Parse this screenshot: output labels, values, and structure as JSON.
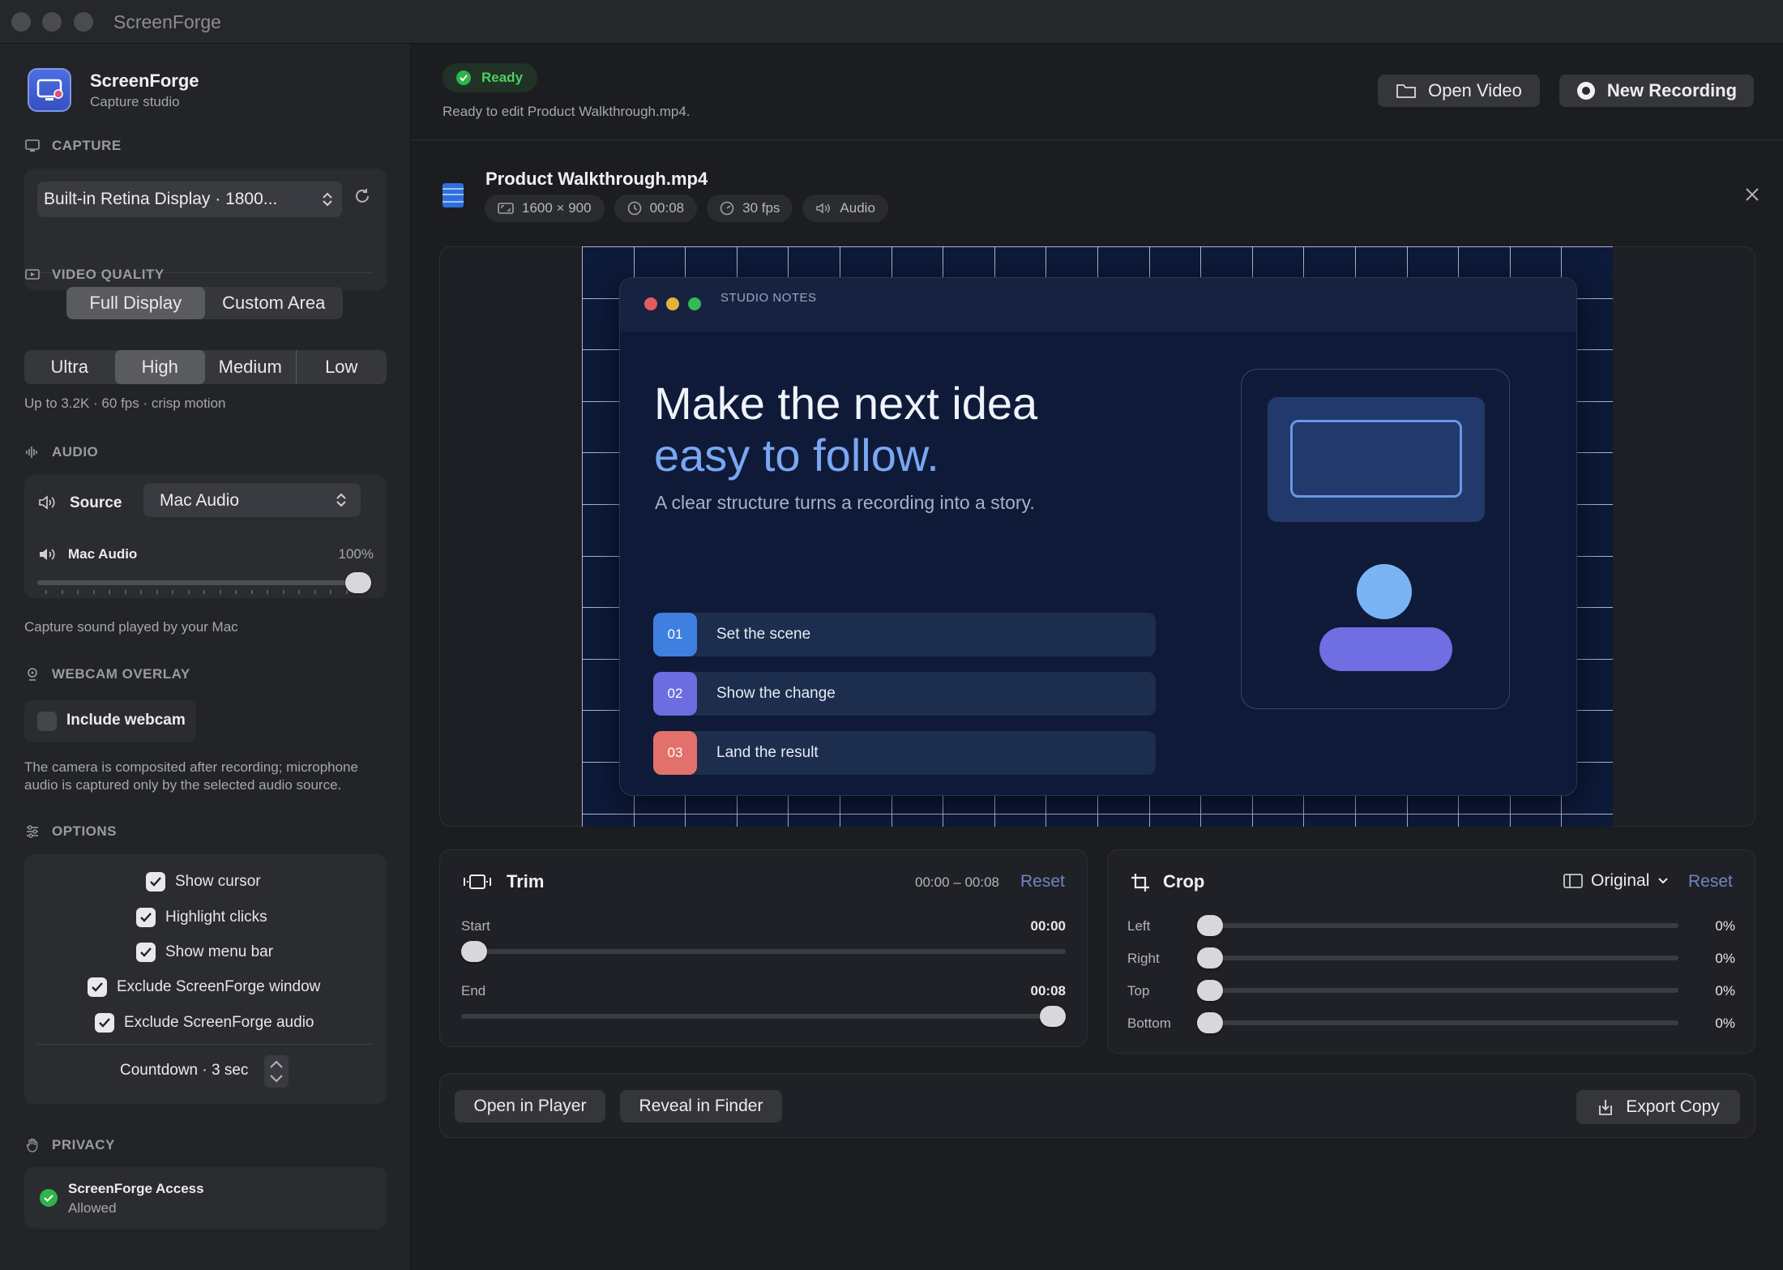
{
  "window": {
    "title": "ScreenForge"
  },
  "sidebar": {
    "app_name": "ScreenForge",
    "app_subtitle": "Capture studio",
    "capture": {
      "heading": "CAPTURE",
      "display": "Built-in Retina Display · 1800...",
      "modes": [
        "Full Display",
        "Custom Area"
      ],
      "selected_mode": "Full Display"
    },
    "video_quality": {
      "heading": "VIDEO QUALITY",
      "options": [
        "Ultra",
        "High",
        "Medium",
        "Low"
      ],
      "selected": "High",
      "description": "Up to 3.2K · 60 fps · crisp motion"
    },
    "audio": {
      "heading": "AUDIO",
      "source_label": "Source",
      "source_value": "Mac Audio",
      "level_label": "Mac Audio",
      "level_text": "100%",
      "level": 1.0,
      "description": "Capture sound played by your Mac"
    },
    "webcam": {
      "heading": "WEBCAM OVERLAY",
      "include_label": "Include webcam",
      "include_checked": false,
      "description_line1": "The camera is composited after recording; microphone",
      "description_line2": "audio is captured only by the selected audio source."
    },
    "options": {
      "heading": "OPTIONS",
      "items": [
        {
          "label": "Show cursor",
          "checked": true
        },
        {
          "label": "Highlight clicks",
          "checked": true
        },
        {
          "label": "Show menu bar",
          "checked": true
        },
        {
          "label": "Exclude ScreenForge window",
          "checked": true
        },
        {
          "label": "Exclude ScreenForge audio",
          "checked": true
        }
      ],
      "countdown": "Countdown · 3 sec"
    },
    "privacy": {
      "heading": "PRIVACY",
      "access_title": "ScreenForge Access",
      "access_status": "Allowed"
    }
  },
  "header": {
    "status_badge": "Ready",
    "status_text": "Ready to edit Product Walkthrough.mp4.",
    "open_video": "Open Video",
    "new_recording": "New Recording"
  },
  "file": {
    "name": "Product Walkthrough.mp4",
    "resolution": "1600 × 900",
    "duration": "00:08",
    "fps": "30 fps",
    "audio": "Audio"
  },
  "preview": {
    "window_title": "STUDIO NOTES",
    "headline_1": "Make the next idea",
    "headline_2": "easy to follow.",
    "subtitle": "A clear structure turns a recording into a story.",
    "steps": [
      {
        "num": "01",
        "label": "Set the scene",
        "color": "#3f7fe0"
      },
      {
        "num": "02",
        "label": "Show the change",
        "color": "#6b6de0"
      },
      {
        "num": "03",
        "label": "Land the result",
        "color": "#e2706b"
      }
    ]
  },
  "trim": {
    "title": "Trim",
    "range": "00:00 – 00:08",
    "reset": "Reset",
    "start_label": "Start",
    "start_value": "00:00",
    "start_pos": 0.0,
    "end_label": "End",
    "end_value": "00:08",
    "end_pos": 1.0
  },
  "crop": {
    "title": "Crop",
    "aspect": "Original",
    "reset": "Reset",
    "rows": [
      {
        "label": "Left",
        "value": "0%"
      },
      {
        "label": "Right",
        "value": "0%"
      },
      {
        "label": "Top",
        "value": "0%"
      },
      {
        "label": "Bottom",
        "value": "0%"
      }
    ]
  },
  "footer": {
    "open_in_player": "Open in Player",
    "reveal_in_finder": "Reveal in Finder",
    "export_copy": "Export Copy"
  },
  "colors": {
    "accent": "#6f86c2",
    "success": "#2fb44a",
    "preview_bg": "#0e1a3a"
  }
}
